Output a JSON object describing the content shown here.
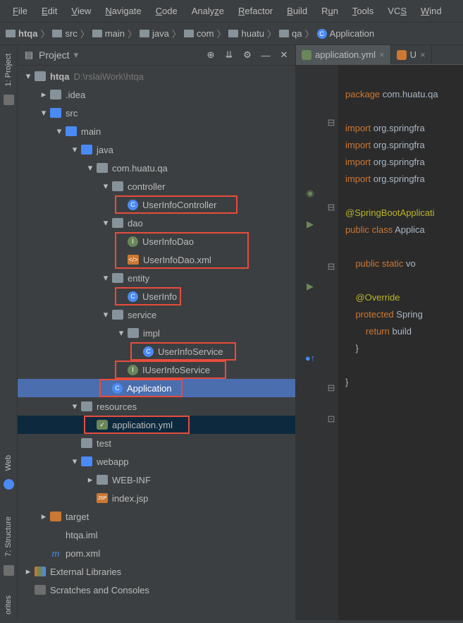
{
  "menu": [
    "File",
    "Edit",
    "View",
    "Navigate",
    "Code",
    "Analyze",
    "Refactor",
    "Build",
    "Run",
    "Tools",
    "VCS",
    "Wind"
  ],
  "menu_underline": [
    0,
    0,
    0,
    0,
    0,
    5,
    0,
    0,
    1,
    0,
    2,
    0
  ],
  "breadcrumb": [
    {
      "label": "htqa",
      "icon": "folder",
      "bold": true
    },
    {
      "label": "src",
      "icon": "folder"
    },
    {
      "label": "main",
      "icon": "folder"
    },
    {
      "label": "java",
      "icon": "folder"
    },
    {
      "label": "com",
      "icon": "folder"
    },
    {
      "label": "huatu",
      "icon": "folder"
    },
    {
      "label": "qa",
      "icon": "folder"
    },
    {
      "label": "Application",
      "icon": "class"
    }
  ],
  "project_header": {
    "title": "Project"
  },
  "sidebar": {
    "project_tab": "1: Project",
    "structure_tab": "7: Structure",
    "favorites_tab": "orites",
    "web_tab": "Web"
  },
  "tree": [
    {
      "i": 0,
      "c": "open",
      "icon": "folder",
      "label": "htqa",
      "extra": "D:\\rslaiWork\\htqa",
      "bold": true
    },
    {
      "i": 1,
      "c": "closed",
      "icon": "folder",
      "label": ".idea"
    },
    {
      "i": 1,
      "c": "open",
      "icon": "folder-blue",
      "label": "src"
    },
    {
      "i": 2,
      "c": "open",
      "icon": "folder-blue",
      "label": "main"
    },
    {
      "i": 3,
      "c": "open",
      "icon": "folder-blue",
      "label": "java"
    },
    {
      "i": 4,
      "c": "open",
      "icon": "package",
      "label": "com.huatu.qa"
    },
    {
      "i": 5,
      "c": "open",
      "icon": "package",
      "label": "controller"
    },
    {
      "i": 6,
      "c": "none",
      "icon": "class",
      "label": "UserInfoController",
      "red": true,
      "box": "tight"
    },
    {
      "i": 5,
      "c": "open",
      "icon": "package",
      "label": "dao"
    },
    {
      "i": 6,
      "c": "none",
      "icon": "interface",
      "label": "UserInfoDao",
      "red": true,
      "box": "group-top"
    },
    {
      "i": 6,
      "c": "none",
      "icon": "xml",
      "label": "UserInfoDao.xml",
      "red": true,
      "box": "group-bottom"
    },
    {
      "i": 5,
      "c": "open",
      "icon": "package",
      "label": "entity"
    },
    {
      "i": 6,
      "c": "none",
      "icon": "class",
      "label": "UserInfo",
      "red": true,
      "box": "tight"
    },
    {
      "i": 5,
      "c": "open",
      "icon": "package",
      "label": "service"
    },
    {
      "i": 6,
      "c": "open",
      "icon": "package",
      "label": "impl"
    },
    {
      "i": 7,
      "c": "none",
      "icon": "class",
      "label": "UserInfoService",
      "red": true,
      "box": "tight"
    },
    {
      "i": 6,
      "c": "none",
      "icon": "interface",
      "label": "IUserInfoService",
      "red": true,
      "box": "tight"
    },
    {
      "i": 5,
      "c": "none",
      "icon": "class",
      "label": "Application",
      "selected": true,
      "red": true,
      "box": "tight"
    },
    {
      "i": 3,
      "c": "open",
      "icon": "folder",
      "label": "resources"
    },
    {
      "i": 4,
      "c": "none",
      "icon": "yml",
      "label": "application.yml",
      "highlighted": true,
      "red": true,
      "box": "tight"
    },
    {
      "i": 3,
      "c": "none",
      "icon": "folder",
      "label": "test"
    },
    {
      "i": 3,
      "c": "open",
      "icon": "folder-blue",
      "label": "webapp"
    },
    {
      "i": 4,
      "c": "closed",
      "icon": "folder",
      "label": "WEB-INF"
    },
    {
      "i": 4,
      "c": "none",
      "icon": "jsp",
      "label": "index.jsp"
    },
    {
      "i": 1,
      "c": "closed",
      "icon": "folder-orange",
      "label": "target"
    },
    {
      "i": 1,
      "c": "none",
      "icon": "module",
      "label": "htqa.iml"
    },
    {
      "i": 1,
      "c": "none",
      "icon": "maven",
      "label": "pom.xml"
    },
    {
      "i": 0,
      "c": "closed",
      "icon": "lib",
      "label": "External Libraries"
    },
    {
      "i": 0,
      "c": "none",
      "icon": "scratch",
      "label": "Scratches and Consoles"
    }
  ],
  "editor_tabs": [
    {
      "label": "application.yml",
      "active": true,
      "icon": "yml"
    },
    {
      "label": "U",
      "active": false,
      "icon": "xml"
    }
  ],
  "code": {
    "l1_kw": "package",
    "l1_txt": " com.huatu.qa",
    "l3_kw": "import",
    "l3_txt": " org.springfra",
    "l4_kw": "import",
    "l4_txt": " org.springfra",
    "l5_kw": "import",
    "l5_txt": " org.springfra",
    "l6_kw": "import",
    "l6_txt": " org.springfra",
    "l8_ann": "@SpringBootApplicati",
    "l9_kw": "public class",
    "l9_txt": " Applica",
    "l11_kw": "    public static",
    "l11_txt": " vo",
    "l13_ann": "    @Override",
    "l14_kw": "    protected",
    "l14_txt": " Spring",
    "l15_kw": "        return",
    "l15_txt": " build",
    "l16": "    }",
    "l18": "}"
  }
}
